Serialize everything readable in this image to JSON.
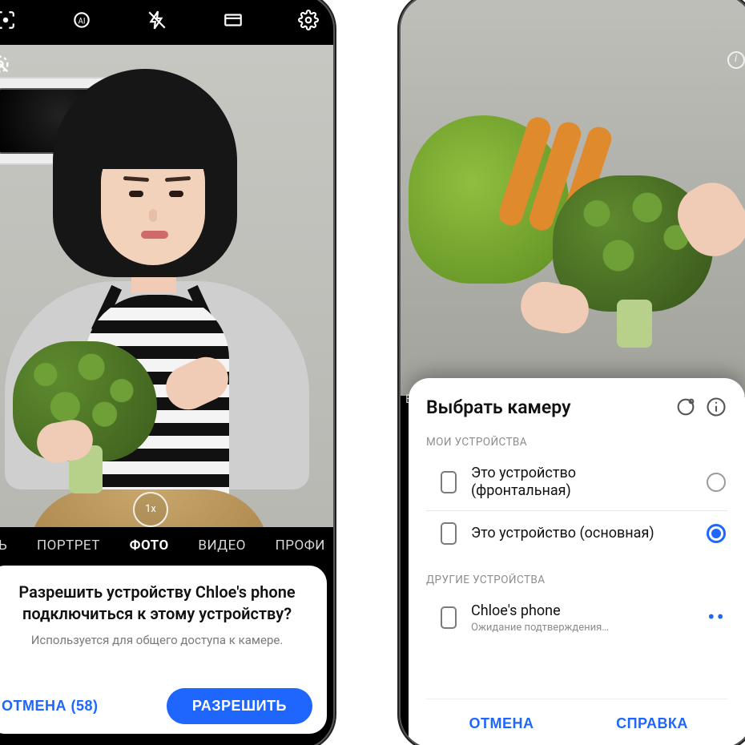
{
  "left": {
    "topbar": {
      "icons": [
        "scan-icon",
        "ai-icon",
        "flash-off-icon",
        "aspect-ratio-icon",
        "settings-icon"
      ],
      "motion_off_icon": "motion-photo-off-icon",
      "zoom_label": "1x"
    },
    "modes": {
      "items": [
        "ЧЬ",
        "ПОРТРЕТ",
        "ФОТО",
        "ВИДЕО",
        "ПРОФИ"
      ],
      "active_index": 2
    },
    "dialog": {
      "title_line1": "Разрешить устройству Chloe's phone",
      "title_line2": "подключиться к этому устройству?",
      "subtitle": "Используется для общего доступа к камере.",
      "cancel_label": "ОТМЕНА (58)",
      "allow_label": "РАЗРЕШИТЬ"
    }
  },
  "right": {
    "viewfinder": {
      "info_icon": "info-icon"
    },
    "mode_snippet": "ЕС",
    "picker": {
      "title": "Выбрать камеру",
      "header_icons": [
        "switch-camera-icon",
        "info-icon"
      ],
      "section_my": "МОИ УСТРОЙСТВА",
      "section_other": "ДРУГИЕ УСТРОЙСТВА",
      "devices_my": [
        {
          "label_line1": "Это устройство",
          "label_line2": "(фронтальная)",
          "selected": false
        },
        {
          "label_line1": "Это устройство (основная)",
          "label_line2": "",
          "selected": true
        }
      ],
      "devices_other": [
        {
          "name": "Chloe's phone",
          "status": "Ожидание подтверждения…"
        }
      ],
      "cancel_label": "ОТМЕНА",
      "help_label": "СПРАВКА"
    }
  }
}
